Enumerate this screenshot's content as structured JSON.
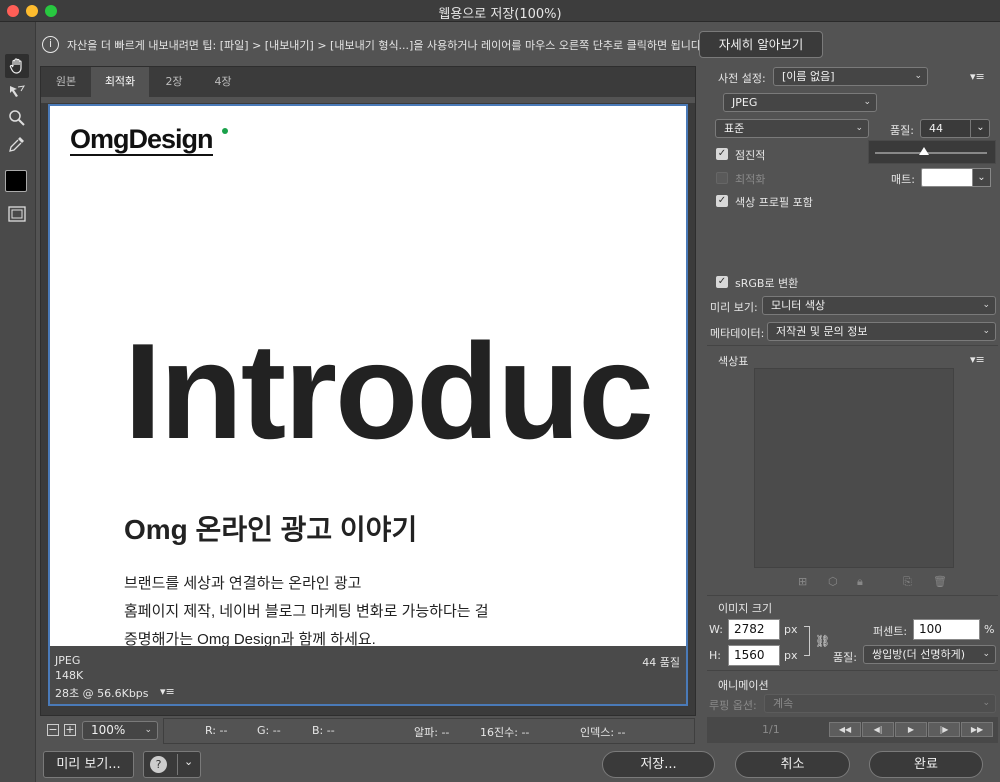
{
  "window": {
    "title": "웹용으로 저장(100%)",
    "traffic": [
      "#ff5f57",
      "#febc2e",
      "#28c840"
    ]
  },
  "tip": {
    "icon": "i",
    "text": "자산을 더 빠르게 내보내려면 팁: [파일] > [내보내기] > [내보내기 형식...]을 사용하거나 레이어를 마우스 오른쪽 단추로 클릭하면 됩니다.",
    "learn_more": "자세히 알아보기"
  },
  "tabs": [
    "원본",
    "최적화",
    "2장",
    "4장"
  ],
  "active_tab": "최적화",
  "preview": {
    "logo": "OmgDesign",
    "big": "Introduc",
    "heading": "Omg 온라인 광고 이야기",
    "lines": [
      "브랜드를 세상과 연결하는 온라인 광고",
      "홈페이지 제작, 네이버 블로그 마케팅 변화로 가능하다는 걸",
      "증명해가는 Omg Design과 함께 하세요."
    ]
  },
  "info": {
    "format": "JPEG",
    "size": "148K",
    "time": "28초 @ 56.6Kbps",
    "quality": "44 품질"
  },
  "zoom": {
    "minus": "−",
    "plus": "+",
    "value": "100%"
  },
  "readout": {
    "r": "R: --",
    "g": "G: --",
    "b": "B: --",
    "alpha": "알파: --",
    "hex": "16진수: --",
    "index": "인덱스: --"
  },
  "buttons": {
    "preview": "미리 보기...",
    "save": "저장...",
    "cancel": "취소",
    "done": "완료"
  },
  "settings": {
    "preset_label": "사전 설정:",
    "preset_value": "[이름 없음]",
    "format": "JPEG",
    "compression": "표준",
    "quality_label": "품질:",
    "quality_value": "44",
    "progressive": "점진적",
    "optimized": "최적화",
    "embed_profile": "색상 프로필 포함",
    "matte_label": "매트:",
    "srgb": "sRGB로 변환",
    "preview_label": "미리 보기:",
    "preview_value": "모니터 색상",
    "metadata_label": "메타데이터:",
    "metadata_value": "저작권 및 문의 정보",
    "color_table": "색상표",
    "image_size": "이미지 크기",
    "w_label": "W:",
    "w_value": "2782",
    "h_label": "H:",
    "h_value": "1560",
    "px": "px",
    "percent_label": "퍼센트:",
    "percent_value": "100",
    "percent_unit": "%",
    "resample_label": "품질:",
    "resample_value": "쌍입방(더 선명하게)",
    "animation": "애니메이션",
    "loop_label": "루핑 옵션:",
    "loop_value": "계속",
    "frame": "1/1"
  },
  "colors": {
    "accent": "#4a7ab8",
    "panel": "#535353",
    "dark": "#3b3b3b"
  }
}
